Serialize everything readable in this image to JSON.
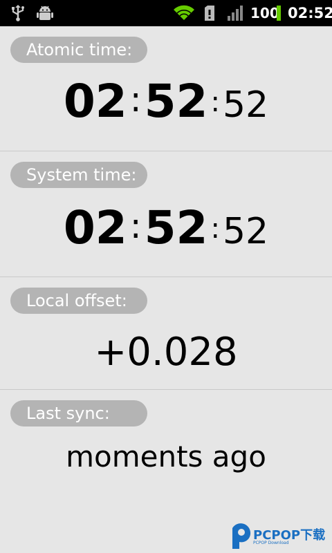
{
  "status_bar": {
    "battery": "100",
    "clock": "02:52",
    "icons": [
      "usb-icon",
      "android-debug-icon",
      "wifi-icon",
      "sd-card-icon",
      "signal-icon",
      "battery-icon"
    ],
    "battery_color": "#66cc00",
    "wifi_color": "#66cc00"
  },
  "sections": {
    "atomic": {
      "label": "Atomic time:",
      "hours": "02",
      "minutes": "52",
      "seconds": "52",
      "separator": ":"
    },
    "system": {
      "label": "System time:",
      "hours": "02",
      "minutes": "52",
      "seconds": "52",
      "separator": ":"
    },
    "offset": {
      "label": "Local offset:",
      "value": "+0.028"
    },
    "sync": {
      "label": "Last sync:",
      "value": "moments ago"
    }
  },
  "watermark": {
    "text": "PCPOP下载",
    "subtext": "PCPOP Download"
  },
  "colors": {
    "background": "#e6e6e6",
    "pill": "#b4b4b4",
    "divider": "#c9c9c9",
    "watermark": "#1a6fc2"
  }
}
